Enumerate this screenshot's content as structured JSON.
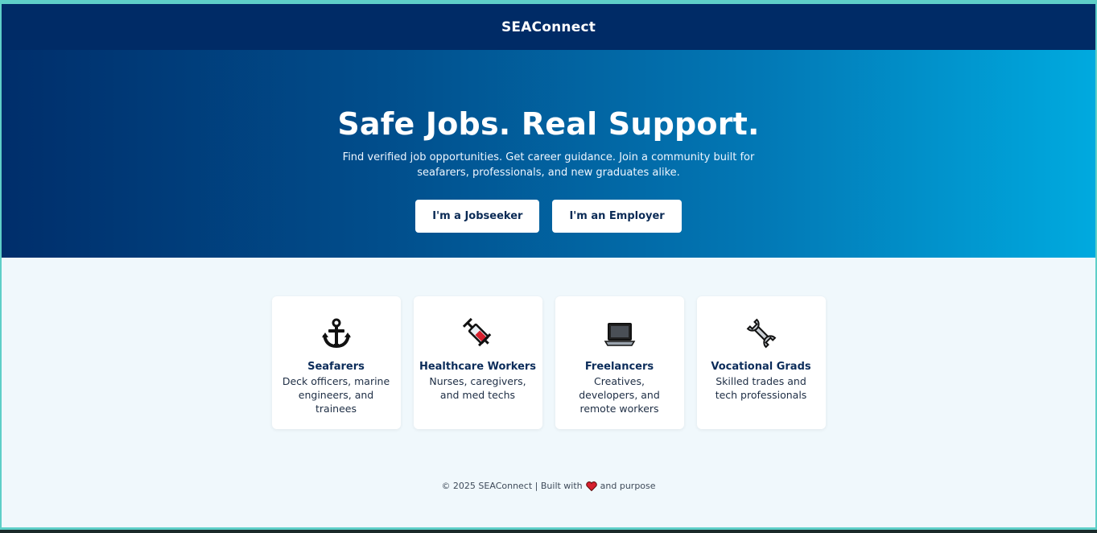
{
  "header": {
    "brand": "SEAConnect"
  },
  "hero": {
    "title": "Safe Jobs. Real Support.",
    "subtitle": "Find verified job opportunities. Get career guidance. Join a community built for seafarers, professionals, and new graduates alike.",
    "buttons": [
      {
        "label": "I'm a Jobseeker"
      },
      {
        "label": "I'm an Employer"
      }
    ]
  },
  "categories": [
    {
      "icon": "anchor-icon",
      "title": "Seafarers",
      "description": "Deck officers, marine engineers, and trainees"
    },
    {
      "icon": "syringe-icon",
      "title": "Healthcare Workers",
      "description": "Nurses, caregivers, and med techs"
    },
    {
      "icon": "laptop-icon",
      "title": "Freelancers",
      "description": "Creatives, developers, and remote workers"
    },
    {
      "icon": "wrench-icon",
      "title": "Vocational Grads",
      "description": "Skilled trades and tech professionals"
    }
  ],
  "footer": {
    "text_before": "© 2025 SEAConnect | Built with",
    "icon": "heart-icon",
    "text_after": "and purpose"
  },
  "colors": {
    "header_bg": "#002b66",
    "hero_gradient_start": "#002e6b",
    "hero_gradient_end": "#00aadf",
    "page_bg": "#f0f8fc",
    "heart": "#d6202e"
  }
}
